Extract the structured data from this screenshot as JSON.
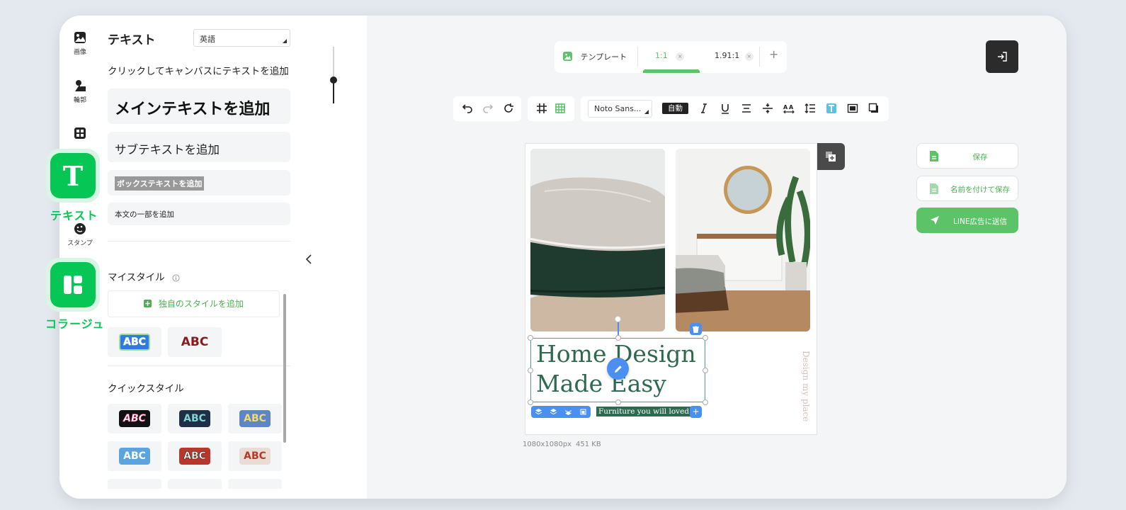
{
  "rail": {
    "items": [
      {
        "label": "画像"
      },
      {
        "label": "輪郭"
      },
      {
        "label": ""
      },
      {
        "label": "スタンプ"
      }
    ]
  },
  "floating": {
    "text_tool": "テキスト",
    "collage_tool": "コラージュ"
  },
  "text_panel": {
    "title": "テキスト",
    "language": "英語",
    "hint": "クリックしてキャンバスにテキストを追加",
    "add_main": "メインテキストを追加",
    "add_sub": "サブテキストを追加",
    "add_box": "ボックステキストを追加",
    "add_body": "本文の一部を追加",
    "my_style_title": "マイスタイル",
    "add_own_style": "独自のスタイルを追加",
    "my_styles": [
      "ABC",
      "ABC"
    ],
    "quick_style_title": "クイックスタイル",
    "quick_styles": [
      "ABC",
      "ABC",
      "ABC",
      "ABC",
      "ABC",
      "ABC"
    ]
  },
  "format_tabs": {
    "template_label": "テンプレート",
    "ratio_1_1": "1:1",
    "ratio_191": "1.91:1",
    "active": "1:1"
  },
  "text_toolbar": {
    "font": "Noto Sans...",
    "size_mode": "自動"
  },
  "canvas": {
    "headline_line1": "Home Design",
    "headline_line2": "Made Easy",
    "tagline": "Furniture you will loved",
    "vertical_text": "Design my place",
    "dimensions": "1080x1080px",
    "file_size": "451 KB"
  },
  "actions": {
    "save": "保存",
    "save_as": "名前を付けて保存",
    "send_line": "LINE広告に送信"
  },
  "colors": {
    "line_green": "#06c755",
    "action_green": "#5cc368",
    "headline_green": "#2e6a4f",
    "selection_blue": "#4b8ff0"
  }
}
